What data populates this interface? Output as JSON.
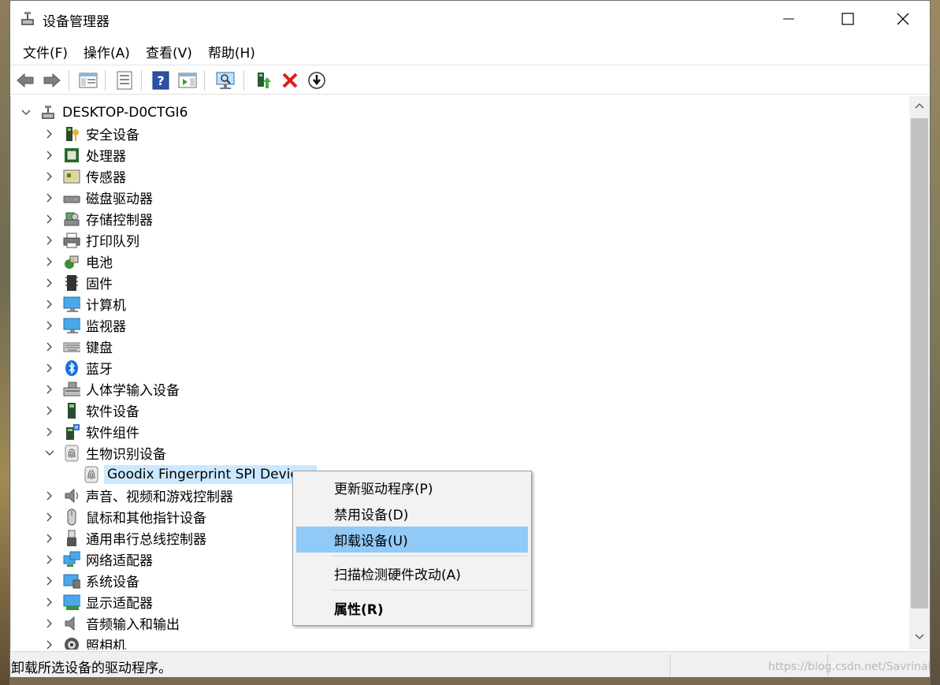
{
  "window": {
    "title": "设备管理器",
    "controls": [
      "minimize-icon",
      "maximize-icon",
      "close-icon"
    ]
  },
  "menubar": {
    "items": [
      "文件(F)",
      "操作(A)",
      "查看(V)",
      "帮助(H)"
    ]
  },
  "toolbar": {
    "buttons": [
      "back-icon",
      "forward-icon",
      "show-hide-console-tree-icon",
      "properties-icon",
      "help-icon",
      "action-pane-icon",
      "scan-hardware-icon",
      "update-driver-icon",
      "uninstall-icon",
      "install-driver-icon"
    ]
  },
  "tree": {
    "root": "DESKTOP-D0CTGI6",
    "categories": [
      {
        "label": "安全设备",
        "icon": "security-device-icon"
      },
      {
        "label": "处理器",
        "icon": "processor-icon"
      },
      {
        "label": "传感器",
        "icon": "sensor-icon"
      },
      {
        "label": "磁盘驱动器",
        "icon": "disk-drive-icon"
      },
      {
        "label": "存储控制器",
        "icon": "storage-controller-icon"
      },
      {
        "label": "打印队列",
        "icon": "printer-icon"
      },
      {
        "label": "电池",
        "icon": "battery-icon"
      },
      {
        "label": "固件",
        "icon": "firmware-icon"
      },
      {
        "label": "计算机",
        "icon": "computer-icon"
      },
      {
        "label": "监视器",
        "icon": "monitor-icon"
      },
      {
        "label": "键盘",
        "icon": "keyboard-icon"
      },
      {
        "label": "蓝牙",
        "icon": "bluetooth-icon"
      },
      {
        "label": "人体学输入设备",
        "icon": "hid-icon"
      },
      {
        "label": "软件设备",
        "icon": "software-device-icon"
      },
      {
        "label": "软件组件",
        "icon": "software-component-icon"
      },
      {
        "label": "生物识别设备",
        "icon": "fingerprint-icon",
        "expanded": true
      },
      {
        "label": "Goodix Fingerprint SPI Device",
        "icon": "fingerprint-icon",
        "child": true,
        "selected": true
      },
      {
        "label": "声音、视频和游戏控制器",
        "icon": "speaker-icon"
      },
      {
        "label": "鼠标和其他指针设备",
        "icon": "mouse-icon"
      },
      {
        "label": "通用串行总线控制器",
        "icon": "usb-icon"
      },
      {
        "label": "网络适配器",
        "icon": "network-adapter-icon"
      },
      {
        "label": "系统设备",
        "icon": "system-device-icon"
      },
      {
        "label": "显示适配器",
        "icon": "display-adapter-icon"
      },
      {
        "label": "音频输入和输出",
        "icon": "audio-icon"
      },
      {
        "label": "照相机",
        "icon": "camera-icon"
      }
    ]
  },
  "context_menu": {
    "items": [
      "更新驱动程序(P)",
      "禁用设备(D)",
      "卸载设备(U)",
      "扫描检测硬件改动(A)",
      "属性(R)"
    ],
    "highlighted": "卸载设备(U)"
  },
  "status": {
    "text": "卸载所选设备的驱动程序。"
  },
  "watermark": "https://blog.csdn.net/Savrinal",
  "colors": {
    "selection": "#cce8ff",
    "menu_highlight": "#91c9f7"
  }
}
